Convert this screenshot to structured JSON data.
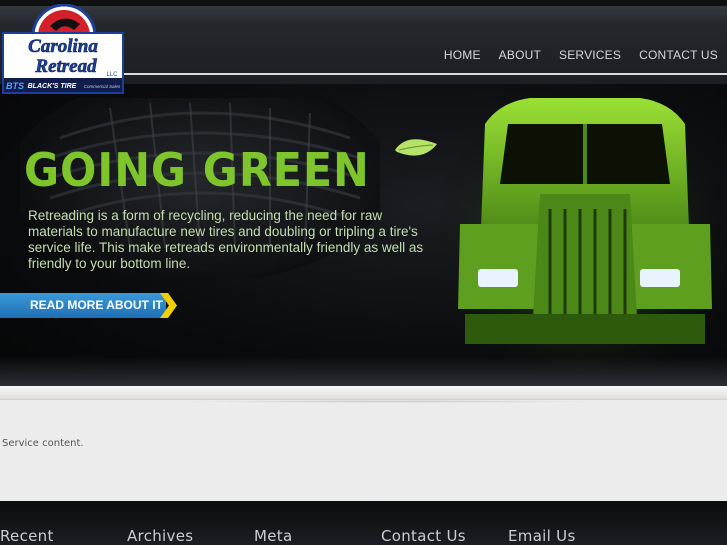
{
  "logo": {
    "line1": "Carolina",
    "line2": "Retread",
    "suffix": "LLC",
    "badge": "BTS",
    "tagline": "BLACK'S TIRE",
    "tagline2": "Commercial Sales"
  },
  "nav": {
    "items": [
      "HOME",
      "ABOUT",
      "SERVICES",
      "CONTACT US"
    ]
  },
  "hero": {
    "title": "GOING GREEN",
    "text": "Retreading is a form of recycling, reducing the need for raw materials to manufacture new tires and doubling or tripling a tire's service life. This make retreads environmentally friendly as well as friendly to your bottom line.",
    "cta_label": "READ MORE ABOUT IT"
  },
  "content": {
    "text": "Service content."
  },
  "footer": {
    "columns": [
      "Recent",
      "Archives",
      "Meta",
      "Contact Us",
      "Email Us"
    ]
  },
  "colors": {
    "accent_green": "#7dc52a",
    "cta_blue": "#1e6fb3",
    "cta_chevron": "#f2d000",
    "logo_red": "#d3202a",
    "logo_blue": "#1d3f9a"
  }
}
